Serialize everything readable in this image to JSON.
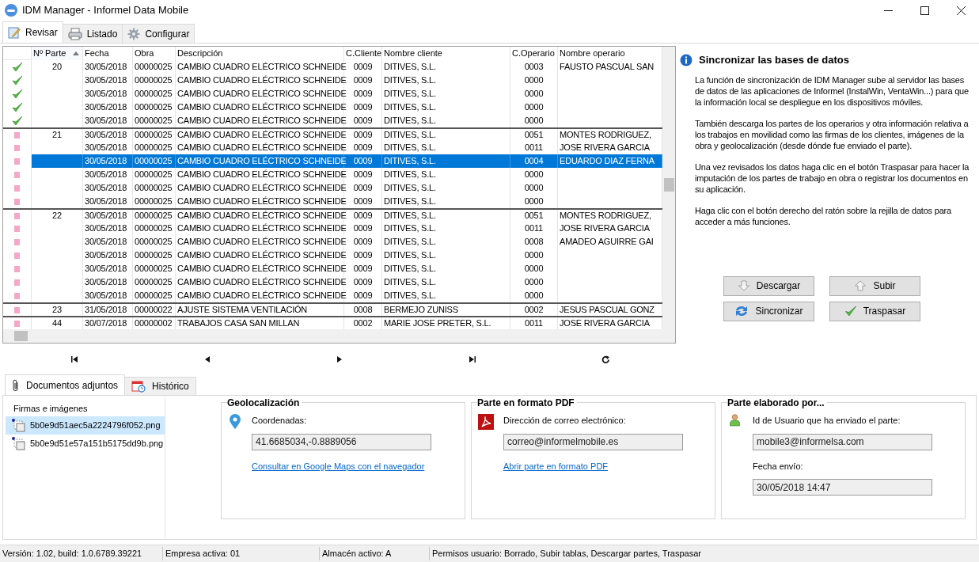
{
  "window": {
    "title": "IDM Manager - Informel Data Mobile"
  },
  "tabs": [
    {
      "label": "Revisar",
      "selected": true
    },
    {
      "label": "Listado",
      "selected": false
    },
    {
      "label": "Configurar",
      "selected": false
    }
  ],
  "grid": {
    "columns": [
      {
        "label": "Nº Parte",
        "sorted": true
      },
      {
        "label": "Fecha",
        "sorted": false
      },
      {
        "label": "Obra",
        "sorted": false
      },
      {
        "label": "Descripción",
        "sorted": false
      },
      {
        "label": "C.Cliente",
        "sorted": false
      },
      {
        "label": "Nombre cliente",
        "sorted": false
      },
      {
        "label": "C.Operario",
        "sorted": false
      },
      {
        "label": "Nombre operario",
        "sorted": false
      }
    ],
    "rows": [
      {
        "kind": "check",
        "group_start": false,
        "selected": false,
        "cells": [
          "20",
          "30/05/2018",
          "00000025",
          "CAMBIO CUADRO ELÉCTRICO SCHNEIDE",
          "0009",
          "DITIVES, S.L.",
          "0003",
          "FAUSTO PASCUAL SAN"
        ]
      },
      {
        "kind": "check",
        "group_start": false,
        "selected": false,
        "cells": [
          "",
          "30/05/2018",
          "00000025",
          "CAMBIO CUADRO ELÉCTRICO SCHNEIDE",
          "0009",
          "DITIVES, S.L.",
          "0000",
          ""
        ]
      },
      {
        "kind": "check",
        "group_start": false,
        "selected": false,
        "cells": [
          "",
          "30/05/2018",
          "00000025",
          "CAMBIO CUADRO ELÉCTRICO SCHNEIDE",
          "0009",
          "DITIVES, S.L.",
          "0000",
          ""
        ]
      },
      {
        "kind": "check",
        "group_start": false,
        "selected": false,
        "cells": [
          "",
          "30/05/2018",
          "00000025",
          "CAMBIO CUADRO ELÉCTRICO SCHNEIDE",
          "0009",
          "DITIVES, S.L.",
          "0000",
          ""
        ]
      },
      {
        "kind": "check",
        "group_start": false,
        "selected": false,
        "cells": [
          "",
          "30/05/2018",
          "00000025",
          "CAMBIO CUADRO ELÉCTRICO SCHNEIDE",
          "0009",
          "DITIVES, S.L.",
          "0000",
          ""
        ]
      },
      {
        "kind": "pending",
        "group_start": true,
        "selected": false,
        "cells": [
          "21",
          "30/05/2018",
          "00000025",
          "CAMBIO CUADRO ELÉCTRICO SCHNEIDE",
          "0009",
          "DITIVES, S.L.",
          "0051",
          "MONTES RODRIGUEZ,"
        ]
      },
      {
        "kind": "pending",
        "group_start": false,
        "selected": false,
        "cells": [
          "",
          "30/05/2018",
          "00000025",
          "CAMBIO CUADRO ELÉCTRICO SCHNEIDE",
          "0009",
          "DITIVES, S.L.",
          "0011",
          "JOSE RIVERA GARCIA"
        ]
      },
      {
        "kind": "pending",
        "group_start": false,
        "selected": true,
        "cells": [
          "",
          "30/05/2018",
          "00000025",
          "CAMBIO CUADRO ELÉCTRICO SCHNEIDE",
          "0009",
          "DITIVES, S.L.",
          "0004",
          "EDUARDO DIAZ FERNA"
        ]
      },
      {
        "kind": "pending",
        "group_start": false,
        "selected": false,
        "cells": [
          "",
          "30/05/2018",
          "00000025",
          "CAMBIO CUADRO ELÉCTRICO SCHNEIDE",
          "0009",
          "DITIVES, S.L.",
          "0000",
          ""
        ]
      },
      {
        "kind": "pending",
        "group_start": false,
        "selected": false,
        "cells": [
          "",
          "30/05/2018",
          "00000025",
          "CAMBIO CUADRO ELÉCTRICO SCHNEIDE",
          "0009",
          "DITIVES, S.L.",
          "0000",
          ""
        ]
      },
      {
        "kind": "pending",
        "group_start": false,
        "selected": false,
        "cells": [
          "",
          "30/05/2018",
          "00000025",
          "CAMBIO CUADRO ELÉCTRICO SCHNEIDE",
          "0009",
          "DITIVES, S.L.",
          "0000",
          ""
        ]
      },
      {
        "kind": "pending",
        "group_start": true,
        "selected": false,
        "cells": [
          "22",
          "30/05/2018",
          "00000025",
          "CAMBIO CUADRO ELÉCTRICO SCHNEIDE",
          "0009",
          "DITIVES, S.L.",
          "0051",
          "MONTES RODRIGUEZ,"
        ]
      },
      {
        "kind": "pending",
        "group_start": false,
        "selected": false,
        "cells": [
          "",
          "30/05/2018",
          "00000025",
          "CAMBIO CUADRO ELÉCTRICO SCHNEIDE",
          "0009",
          "DITIVES, S.L.",
          "0011",
          "JOSE RIVERA GARCIA"
        ]
      },
      {
        "kind": "pending",
        "group_start": false,
        "selected": false,
        "cells": [
          "",
          "30/05/2018",
          "00000025",
          "CAMBIO CUADRO ELÉCTRICO SCHNEIDE",
          "0009",
          "DITIVES, S.L.",
          "0008",
          "AMADEO AGUIRRE GAI"
        ]
      },
      {
        "kind": "pending",
        "group_start": false,
        "selected": false,
        "cells": [
          "",
          "30/05/2018",
          "00000025",
          "CAMBIO CUADRO ELÉCTRICO SCHNEIDE",
          "0009",
          "DITIVES, S.L.",
          "0000",
          ""
        ]
      },
      {
        "kind": "pending",
        "group_start": false,
        "selected": false,
        "cells": [
          "",
          "30/05/2018",
          "00000025",
          "CAMBIO CUADRO ELÉCTRICO SCHNEIDE",
          "0009",
          "DITIVES, S.L.",
          "0000",
          ""
        ]
      },
      {
        "kind": "pending",
        "group_start": false,
        "selected": false,
        "cells": [
          "",
          "30/05/2018",
          "00000025",
          "CAMBIO CUADRO ELÉCTRICO SCHNEIDE",
          "0009",
          "DITIVES, S.L.",
          "0000",
          ""
        ]
      },
      {
        "kind": "pending",
        "group_start": false,
        "selected": false,
        "cells": [
          "",
          "30/05/2018",
          "00000025",
          "CAMBIO CUADRO ELÉCTRICO SCHNEIDE",
          "0009",
          "DITIVES, S.L.",
          "0000",
          ""
        ]
      },
      {
        "kind": "pending",
        "group_start": true,
        "selected": false,
        "cells": [
          "23",
          "31/05/2018",
          "00000022",
          "AJUSTE SISTEMA VENTILACIÓN",
          "0008",
          "BERMEJO ZUNISS",
          "0002",
          "JESUS PASCUAL GONZ"
        ]
      },
      {
        "kind": "pending",
        "group_start": true,
        "selected": false,
        "cells": [
          "44",
          "30/07/2018",
          "00000002",
          "TRABAJOS CASA SAN MILLAN",
          "0002",
          "MARIE JOSE PRETER, S.L.",
          "0011",
          "JOSE RIVERA GARCIA"
        ]
      }
    ]
  },
  "info": {
    "title": "Sincronizar las bases de datos",
    "paragraphs": [
      "La función de sincronización de IDM Manager sube al servidor las bases de datos de las aplicaciones de Informel (InstalWin, VentaWin...) para que la información local se despliegue en los dispositivos móviles.",
      "También descarga los partes de los operarios y otra información relativa a los trabajos en movilidad como las firmas de los clientes, imágenes de la obra y geolocalización (desde dónde fue enviado el parte).",
      "Una vez revisados los datos haga clic en el botón Traspasar para hacer la imputación de los partes de trabajo en obra o registrar los documentos en su aplicación.",
      "Haga clic con el botón derecho del ratón sobre la rejilla de datos para acceder a más funciones."
    ],
    "buttons": [
      "Descargar",
      "Subir",
      "Sincronizar",
      "Traspasar"
    ]
  },
  "bottom_tabs": [
    {
      "label": "Documentos adjuntos",
      "selected": true
    },
    {
      "label": "Histórico",
      "selected": false
    }
  ],
  "attachments": {
    "header": "Firmas e imágenes",
    "items": [
      {
        "name": "5b0e9d51aec5a2224796f052.png",
        "selected": true
      },
      {
        "name": "5b0e9d51e57a151b5175dd9b.png",
        "selected": false
      }
    ]
  },
  "geolocation": {
    "title": "Geolocalización",
    "label": "Coordenadas:",
    "value": "41.6685034,-0.8889056",
    "link": "Consultar en Google Maps con el navegador"
  },
  "pdf": {
    "title": "Parte en formato PDF",
    "label": "Dirección de correo electrónico:",
    "value": "correo@informelmobile.es",
    "link": "Abrir parte en formato PDF"
  },
  "author": {
    "title": "Parte elaborado por...",
    "user_label": "Id de Usuario que ha enviado el parte:",
    "user_value": "mobile3@informelsa.com",
    "date_label": "Fecha envío:",
    "date_value": "30/05/2018 14:47"
  },
  "status_bar": [
    "Versión: 1.02, build: 1.0.6789.39221",
    "Empresa activa: 01",
    "Almacén activo: A",
    "Permisos usuario: Borrado, Subir tablas, Descargar partes, Traspasar"
  ]
}
